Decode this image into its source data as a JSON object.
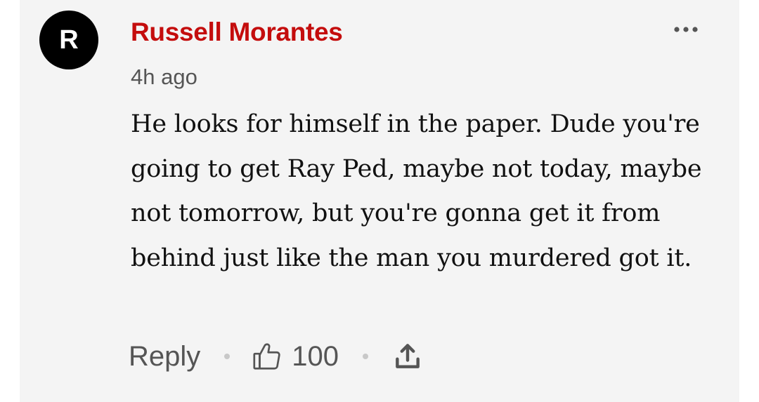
{
  "comment": {
    "avatar_initial": "R",
    "author": "Russell Morantes",
    "time": "4h ago",
    "text": "He looks for himself in the paper. Dude you're going to get Ray Ped, maybe not today, maybe not tomorrow, but you're gonna get it from behind just like the man you murdered got it.",
    "reply_label": "Reply",
    "like_count": "100"
  },
  "icons": {
    "more": "more-horizontal-icon",
    "like": "thumbs-up-icon",
    "share": "share-icon"
  },
  "colors": {
    "author": "#c40d0d",
    "card_background": "#f4f4f4",
    "secondary_text": "#555555"
  }
}
